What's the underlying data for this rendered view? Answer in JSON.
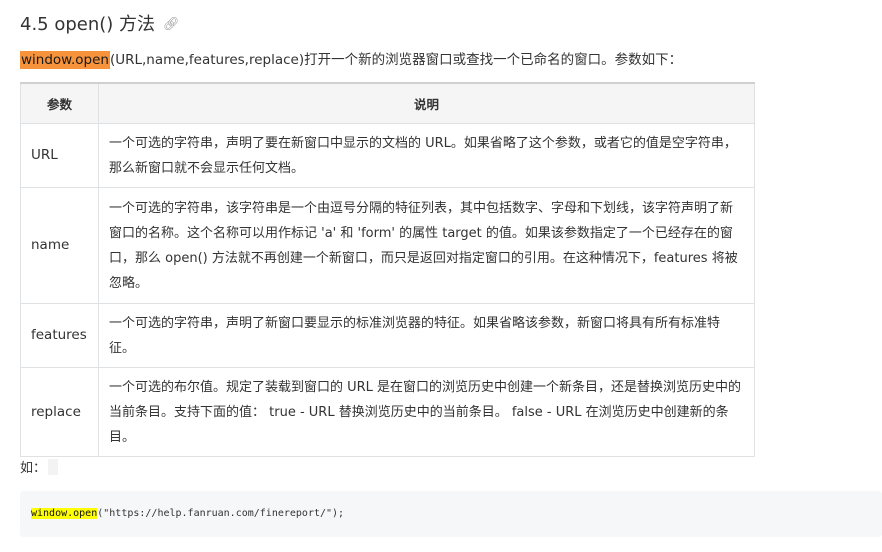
{
  "heading": {
    "title": "4.5 open() 方法",
    "link_icon": "link-icon"
  },
  "intro": {
    "highlight": "window.open",
    "rest": "(URL,name,features,replace)打开一个新的浏览器窗口或查找一个已命名的窗口。参数如下："
  },
  "table": {
    "headers": [
      "参数",
      "说明"
    ],
    "rows": [
      {
        "param": "URL",
        "desc": "一个可选的字符串，声明了要在新窗口中显示的文档的 URL。如果省略了这个参数，或者它的值是空字符串，那么新窗口就不会显示任何文档。"
      },
      {
        "param": "name",
        "desc": "一个可选的字符串，该字符串是一个由逗号分隔的特征列表，其中包括数字、字母和下划线，该字符声明了新窗口的名称。这个名称可以用作标记 'a' 和 'form' 的属性 target 的值。如果该参数指定了一个已经存在的窗口，那么 open() 方法就不再创建一个新窗口，而只是返回对指定窗口的引用。在这种情况下，features 将被忽略。"
      },
      {
        "param": "features",
        "desc": "一个可选的字符串，声明了新窗口要显示的标准浏览器的特征。如果省略该参数，新窗口将具有所有标准特征。"
      },
      {
        "param": "replace",
        "desc": "一个可选的布尔值。规定了装载到窗口的 URL 是在窗口的浏览历史中创建一个新条目，还是替换浏览历史中的当前条目。支持下面的值： true - URL 替换浏览历史中的当前条目。 false - URL 在浏览历史中创建新的条目。"
      }
    ]
  },
  "example": {
    "label": "如：",
    "code_highlight": "window.open",
    "code_rest": "(\"https://help.fanruan.com/finereport/\");"
  }
}
